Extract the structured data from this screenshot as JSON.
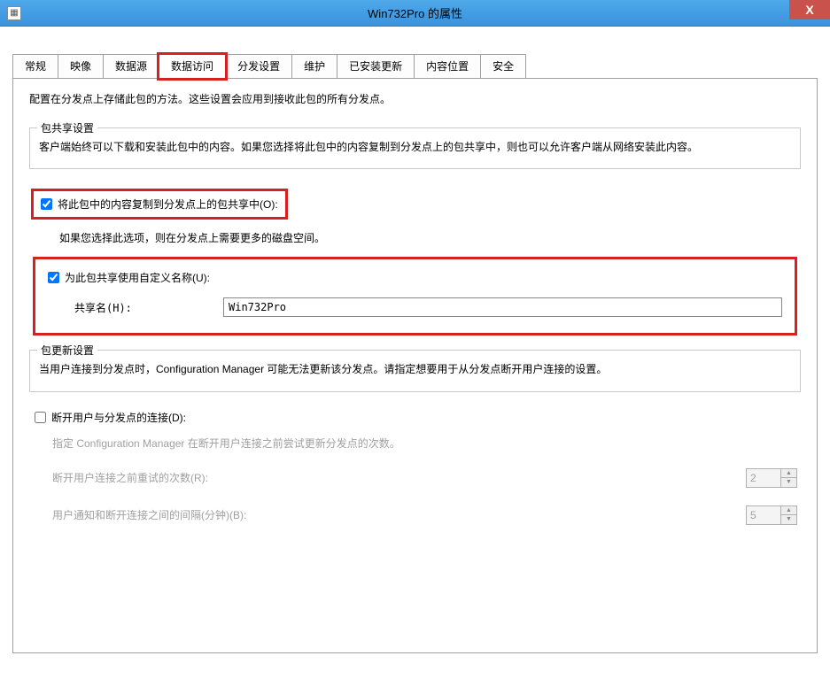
{
  "titlebar": {
    "title": "Win732Pro 的属性",
    "close": "X"
  },
  "tabs": [
    {
      "label": "常规"
    },
    {
      "label": "映像"
    },
    {
      "label": "数据源"
    },
    {
      "label": "数据访问",
      "active": true,
      "highlight": true
    },
    {
      "label": "分发设置"
    },
    {
      "label": "维护"
    },
    {
      "label": "已安装更新"
    },
    {
      "label": "内容位置"
    },
    {
      "label": "安全"
    }
  ],
  "intro": "配置在分发点上存储此包的方法。这些设置会应用到接收此包的所有分发点。",
  "share_group": {
    "legend": "包共享设置",
    "desc": "客户端始终可以下载和安装此包中的内容。如果您选择将此包中的内容复制到分发点上的包共享中，则也可以允许客户端从网络安装此内容。"
  },
  "copy_checkbox": {
    "label": "将此包中的内容复制到分发点上的包共享中(O):",
    "checked": true
  },
  "copy_note": "如果您选择此选项，则在分发点上需要更多的磁盘空间。",
  "custom_name_checkbox": {
    "label": "为此包共享使用自定义名称(U):",
    "checked": true
  },
  "share_name": {
    "label": "共享名(H):",
    "value": "Win732Pro"
  },
  "update_group": {
    "legend": "包更新设置",
    "desc": "当用户连接到分发点时，Configuration Manager 可能无法更新该分发点。请指定想要用于从分发点断开用户连接的设置。"
  },
  "disconnect_checkbox": {
    "label": "断开用户与分发点的连接(D):",
    "checked": false
  },
  "disconnect_note": "指定 Configuration Manager 在断开用户连接之前尝试更新分发点的次数。",
  "retry_count": {
    "label": "断开用户连接之前重试的次数(R):",
    "value": "2"
  },
  "interval": {
    "label": "用户通知和断开连接之间的间隔(分钟)(B):",
    "value": "5"
  }
}
